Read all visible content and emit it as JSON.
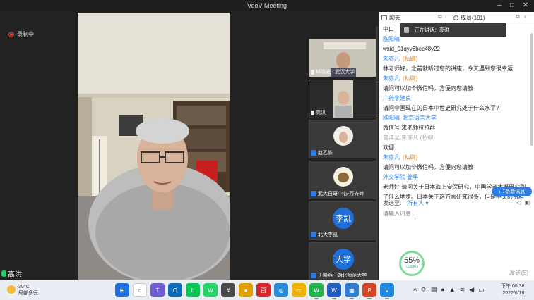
{
  "window": {
    "title": "VooV Meeting",
    "controls": [
      "–",
      "□",
      "✕"
    ]
  },
  "recording": {
    "label": "录制中"
  },
  "speaker": {
    "name": "高洪"
  },
  "participants": [
    {
      "name": "林晓光 - 武汉大学",
      "kind": "video",
      "active": false
    },
    {
      "name": "高洪",
      "kind": "video",
      "active": true
    },
    {
      "name": "赵乙姝",
      "kind": "photo",
      "active": false
    },
    {
      "name": "武大日研中心-万齐岭",
      "kind": "photo",
      "active": false
    },
    {
      "name": "北大李凯",
      "kind": "avatar",
      "avatar": "李凯",
      "active": false
    },
    {
      "name": "王晓燕 - 湖北师范大学",
      "kind": "avatar",
      "avatar": "大学",
      "active": false
    }
  ],
  "speaking_banner": {
    "text": "正在讲话：高洪"
  },
  "chat": {
    "tab_chat": "聊天",
    "tab_members": "成员(191)",
    "messages": [
      {
        "type": "text",
        "text": "中口"
      },
      {
        "type": "sender",
        "name": "欧阳晴",
        "target": "",
        "private": false
      },
      {
        "type": "text",
        "text": "wxid_01qyy6bec48y22"
      },
      {
        "type": "sender",
        "name": "朱亦凡",
        "target": "",
        "private": true
      },
      {
        "type": "text",
        "text": "林老师好，之前就听过您的讲座，今天遇到您很幸运"
      },
      {
        "type": "sender",
        "name": "朱亦凡",
        "target": "",
        "private": true
      },
      {
        "type": "text",
        "text": "请问可以加个微信吗，方便向您请教"
      },
      {
        "type": "sender",
        "name": "广药李建良",
        "target": "",
        "private": false
      },
      {
        "type": "text",
        "text": "请问中国现在的日本中世史研究处于什么水平?"
      },
      {
        "type": "sender",
        "name": "欧阳晴",
        "target": "北京语言大学",
        "private": false
      },
      {
        "type": "text",
        "text": "微信号 求老师拉拉群"
      },
      {
        "type": "faded",
        "text": "曾洋至 朱亦凡 (私聊)"
      },
      {
        "type": "text",
        "text": "欢迎"
      },
      {
        "type": "sender",
        "name": "朱亦凡",
        "target": "",
        "private": true
      },
      {
        "type": "text",
        "text": "请问可以加个微信吗，方便向您请教"
      },
      {
        "type": "sender",
        "name": "外交学院 姜早",
        "target": "",
        "private": false
      },
      {
        "type": "text",
        "text": "老师好 请问关于日本海上安保研究，中国学者大概研究到"
      },
      {
        "type": "text",
        "text": "了什么地步。日本关于这方面研究很多，但是中文的资料"
      }
    ],
    "private_label": "(私聊)",
    "new_messages": "1条新讯息",
    "send_to_label": "发送至:",
    "send_to_value": "所有人",
    "input_placeholder": "请输入讯息...",
    "send_label": "发送(S)"
  },
  "network": {
    "percent": "55%",
    "speed": "↑126K/s"
  },
  "taskbar": {
    "weather_temp": "30°C",
    "weather_desc": "局部多云",
    "time": "下午 08:38",
    "date": "2022/6/18",
    "apps": [
      {
        "name": "start",
        "color": "#1f6fe0",
        "glyph": "⊞"
      },
      {
        "name": "search",
        "color": "#ffffff",
        "glyph": "○"
      },
      {
        "name": "teams",
        "color": "#6b5fd3",
        "glyph": "T"
      },
      {
        "name": "outlook",
        "color": "#0f6cbd",
        "glyph": "O"
      },
      {
        "name": "line",
        "color": "#06c755",
        "glyph": "L"
      },
      {
        "name": "whatsapp",
        "color": "#25d366",
        "glyph": "W"
      },
      {
        "name": "calculator",
        "color": "#4a4a4a",
        "glyph": "#"
      },
      {
        "name": "chrome",
        "color": "#e0a100",
        "glyph": "●"
      },
      {
        "name": "red-app",
        "color": "#d6262d",
        "glyph": "百"
      },
      {
        "name": "globe",
        "color": "#2a8bd8",
        "glyph": "◎"
      },
      {
        "name": "folder",
        "color": "#f0b400",
        "glyph": "▭"
      },
      {
        "name": "wechat",
        "color": "#24b34b",
        "glyph": "W"
      },
      {
        "name": "word",
        "color": "#1f5fbf",
        "glyph": "W"
      },
      {
        "name": "photos",
        "color": "#2d7dd2",
        "glyph": "▦"
      },
      {
        "name": "powerpoint",
        "color": "#d24726",
        "glyph": "P"
      },
      {
        "name": "voov",
        "color": "#1e88e5",
        "glyph": "V"
      }
    ]
  }
}
